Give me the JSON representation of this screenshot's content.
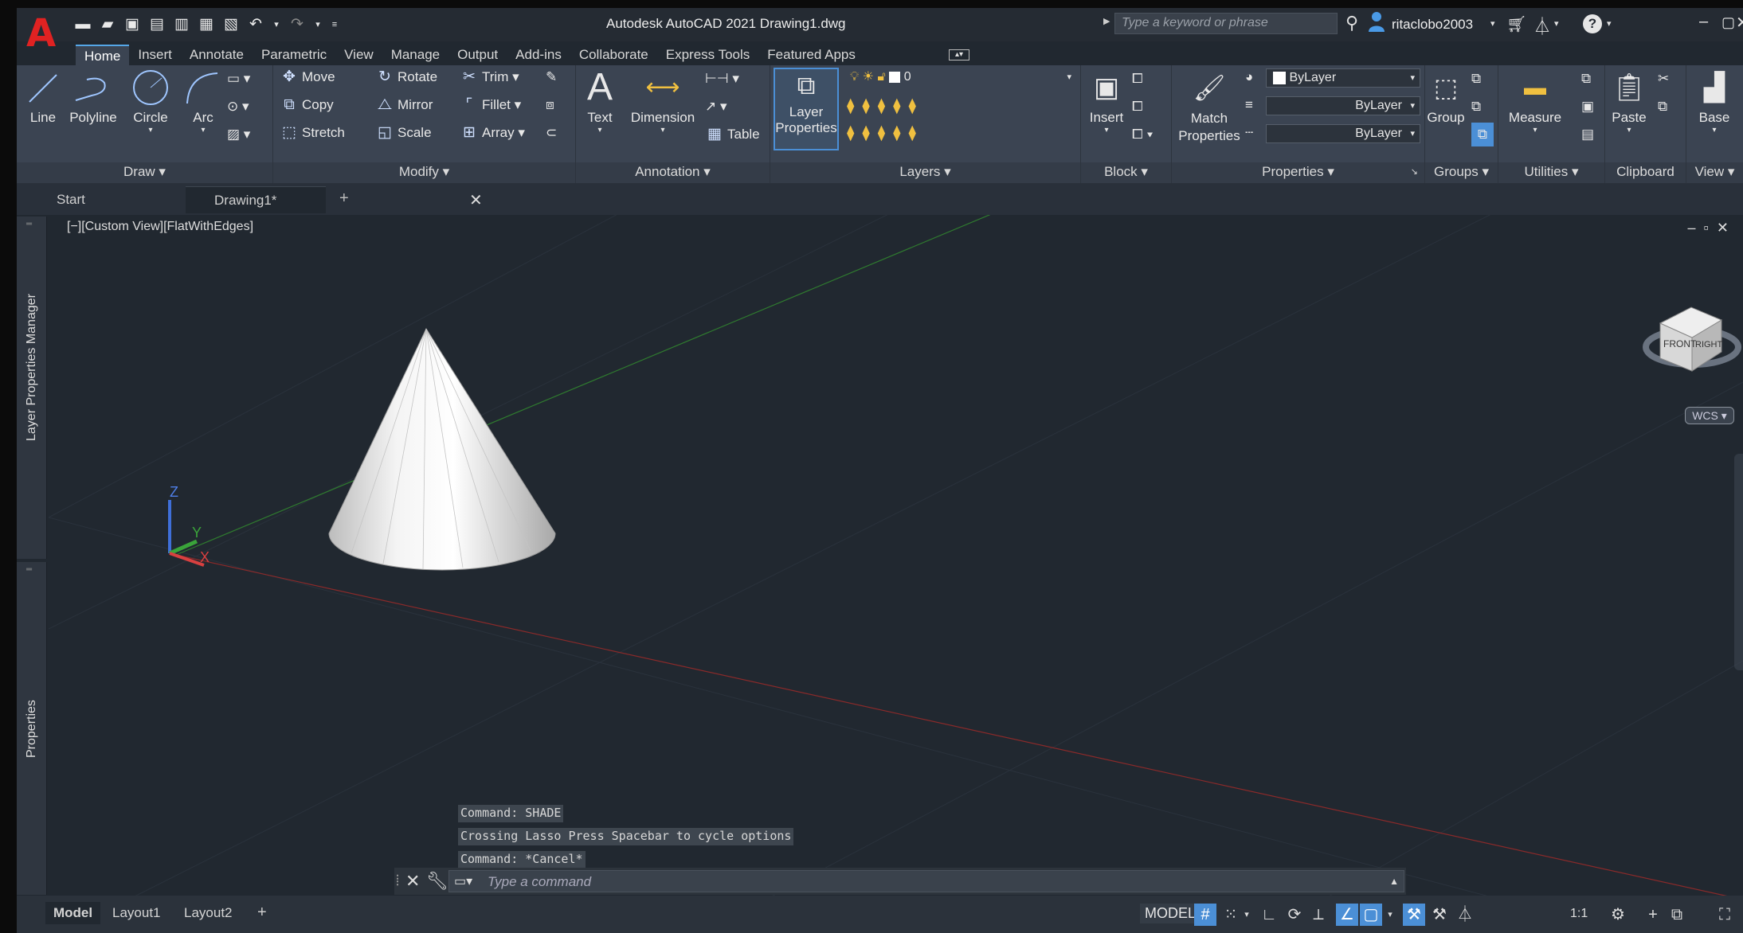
{
  "app": {
    "title": "Autodesk AutoCAD 2021   Drawing1.dwg",
    "logo": "A",
    "search_placeholder": "Type a keyword or phrase",
    "username": "ritaclobo2003"
  },
  "qat_icons": [
    "new-icon",
    "open-icon",
    "save-icon",
    "save-as-icon",
    "open-web-icon",
    "share-icon",
    "plot-icon",
    "undo-icon",
    "redo-icon",
    "customize-icon"
  ],
  "ribbon_tabs": [
    "Home",
    "Insert",
    "Annotate",
    "Parametric",
    "View",
    "Manage",
    "Output",
    "Add-ins",
    "Collaborate",
    "Express Tools",
    "Featured Apps"
  ],
  "active_tab": "Home",
  "draw": {
    "title": "Draw",
    "line": "Line",
    "polyline": "Polyline",
    "circle": "Circle",
    "arc": "Arc"
  },
  "modify": {
    "title": "Modify",
    "move": "Move",
    "rotate": "Rotate",
    "trim": "Trim",
    "copy": "Copy",
    "mirror": "Mirror",
    "fillet": "Fillet",
    "stretch": "Stretch",
    "scale": "Scale",
    "array": "Array"
  },
  "annotation": {
    "title": "Annotation",
    "text": "Text",
    "dimension": "Dimension",
    "table": "Table"
  },
  "layers": {
    "title": "Layers",
    "layer_properties": "Layer Properties",
    "current_layer": "0"
  },
  "block": {
    "title": "Block",
    "insert": "Insert"
  },
  "properties": {
    "title": "Properties",
    "match": "Match Properties",
    "color": "ByLayer",
    "linetype": "ByLayer",
    "lineweight": "ByLayer"
  },
  "groups": {
    "title": "Groups",
    "group": "Group"
  },
  "utilities": {
    "title": "Utilities",
    "measure": "Measure"
  },
  "clipboard": {
    "title": "Clipboard",
    "paste": "Paste"
  },
  "view_panel": {
    "title": "View",
    "base": "Base"
  },
  "doc_tabs": {
    "start": "Start",
    "drawing": "Drawing1*"
  },
  "side_palettes": {
    "layer_manager": "Layer Properties Manager",
    "properties": "Properties"
  },
  "viewport": {
    "label": "[−][Custom View][FlatWithEdges]",
    "viewcube_front": "FRONT",
    "viewcube_right": "RIGHT",
    "wcs": "WCS",
    "axis_x": "X",
    "axis_y": "Y",
    "axis_z": "Z"
  },
  "command_history": [
    "Command: SHADE",
    "Crossing Lasso  Press Spacebar to cycle options",
    "Command: *Cancel*"
  ],
  "command_placeholder": "Type a command",
  "layout_tabs": [
    "Model",
    "Layout1",
    "Layout2"
  ],
  "status": {
    "model": "MODEL",
    "scale": "1:1"
  },
  "colors": {
    "accent": "#4b8fd6",
    "background": "#212830",
    "ribbon": "#3b4452",
    "logo": "#e02222"
  }
}
